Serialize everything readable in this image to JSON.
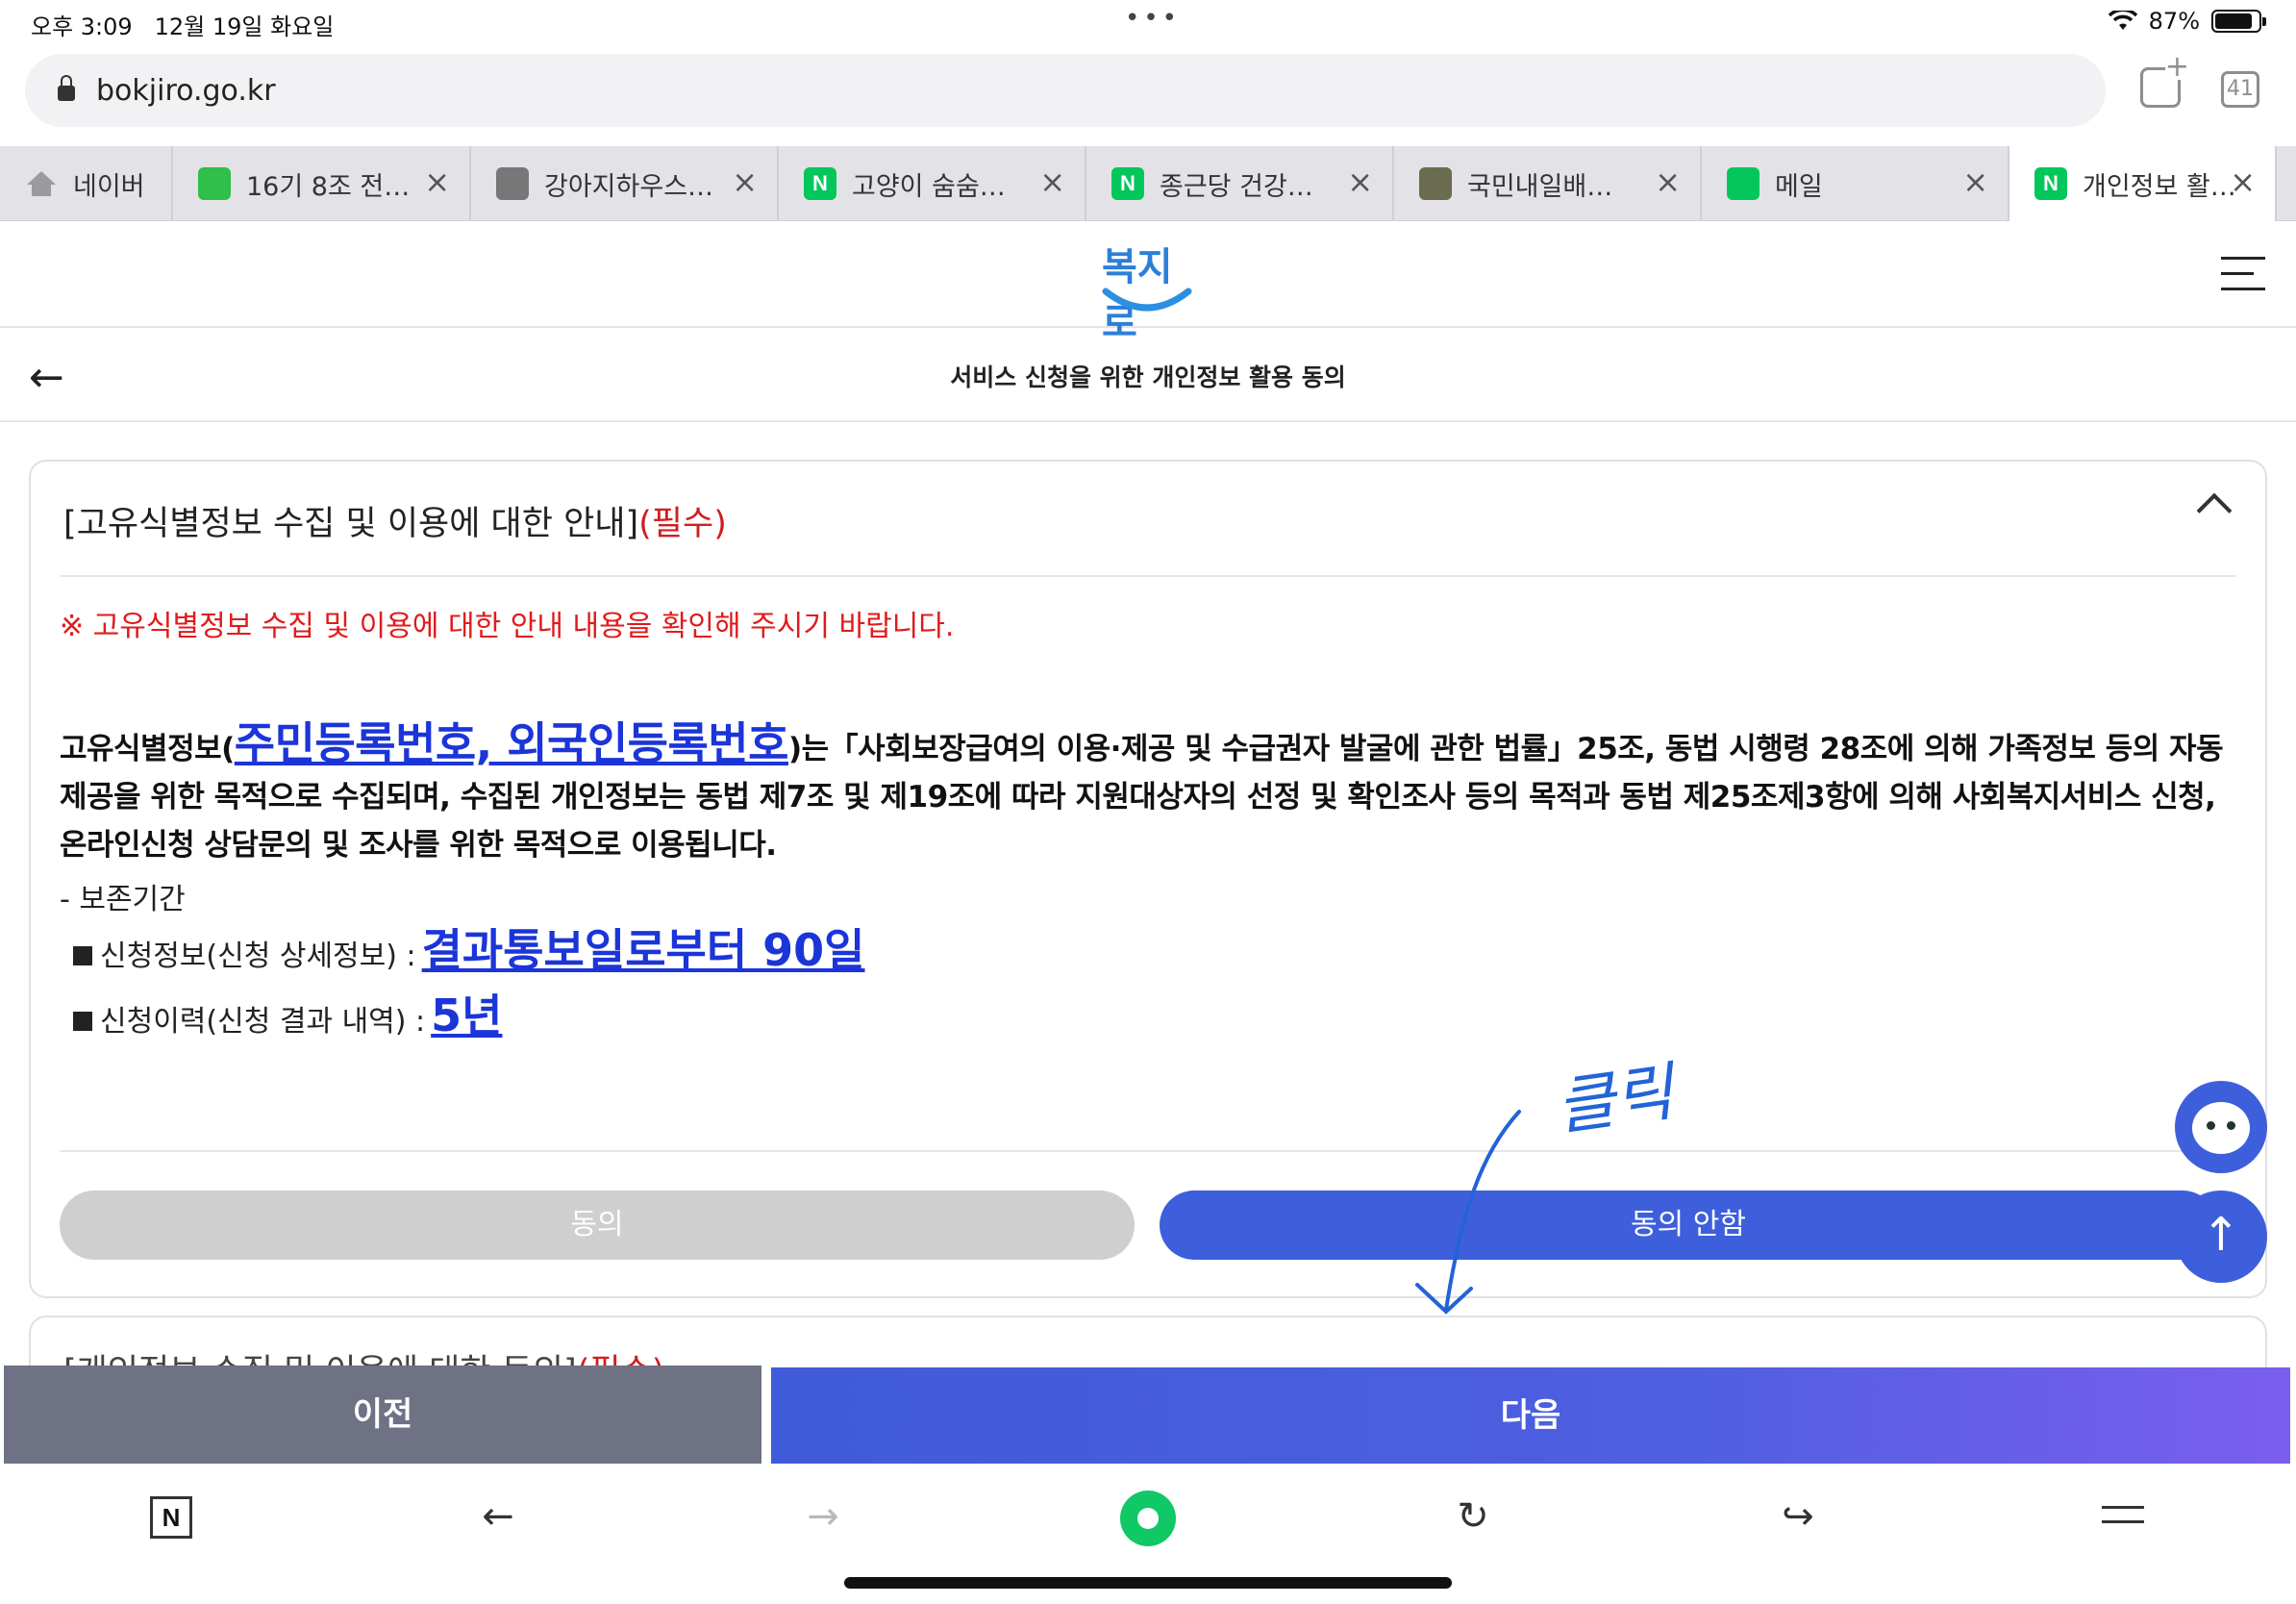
{
  "status_bar": {
    "time": "오후 3:09",
    "date": "12월 19일 화요일",
    "battery": "87%",
    "battery_level": 0.87
  },
  "browser": {
    "url": "bokjiro.go.kr",
    "tab_count": "41",
    "tabs": [
      {
        "title": "네이버",
        "icon": "home-icon",
        "color": "#9b9b9f"
      },
      {
        "title": "16기 8조 전…",
        "icon": "cafe-icon",
        "color": "#2fbf4a"
      },
      {
        "title": "강아지하우스…",
        "icon": "pet-logo-icon",
        "color": "#777777"
      },
      {
        "title": "고양이 숨숨…",
        "icon": "naver-n-icon",
        "color": "#03c75a",
        "letter": "N"
      },
      {
        "title": "종근당 건강…",
        "icon": "naver-n-icon",
        "color": "#03c75a",
        "letter": "N"
      },
      {
        "title": "국민내일배…",
        "icon": "brain-icon",
        "color": "#6b6b4f"
      },
      {
        "title": "메일",
        "icon": "mail-icon",
        "color": "#03c75a"
      },
      {
        "title": "개인정보 활…",
        "icon": "naver-n-icon",
        "color": "#03c75a",
        "letter": "N"
      }
    ]
  },
  "site": {
    "logo_text": "복지로"
  },
  "page": {
    "title": "서비스 신청을 위한 개인정보 활용 동의",
    "section": {
      "heading": "[고유식별정보 수집 및 이용에 대한 안내]",
      "required": "(필수)",
      "notice": "※ 고유식별정보 수집 및 이용에 대한 안내 내용을 확인해 주시기 바랍니다.",
      "body_prefix": "고유식별정보(",
      "body_highlight": "주민등록번호, 외국인등록번호",
      "body_suffix": ")는「사회보장급여의 이용·제공 및 수급권자 발굴에 관한 법률」25조, 동법 시행령 28조에 의해 가족정보 등의 자동 제공을 위한 목적으로 수집되며, 수집된 개인정보는 동법 제7조 및 제19조에 따라 지원대상자의 선정 및 확인조사 등의 목적과 동법 제25조제3항에 의해 사회복지서비스 신청, 온라인신청 상담문의 및 조사를 위한 목적으로 이용됩니다.",
      "period_label": "- 보존기간",
      "retention": [
        {
          "label": "신청정보(신청 상세정보) :",
          "value": "결과통보일로부터 90일"
        },
        {
          "label": "신청이력(신청 결과 내역) :",
          "value": "5년"
        }
      ],
      "agree_label": "동의",
      "disagree_label": "동의 안함"
    },
    "next_section": {
      "heading": "[개인정보 수집 및 이용에 대한 동의]",
      "required": "(필수)"
    },
    "prev_label": "이전",
    "next_label": "다음"
  },
  "annotation": {
    "text": "클릭"
  },
  "toolbar": {
    "n_label": "N"
  }
}
